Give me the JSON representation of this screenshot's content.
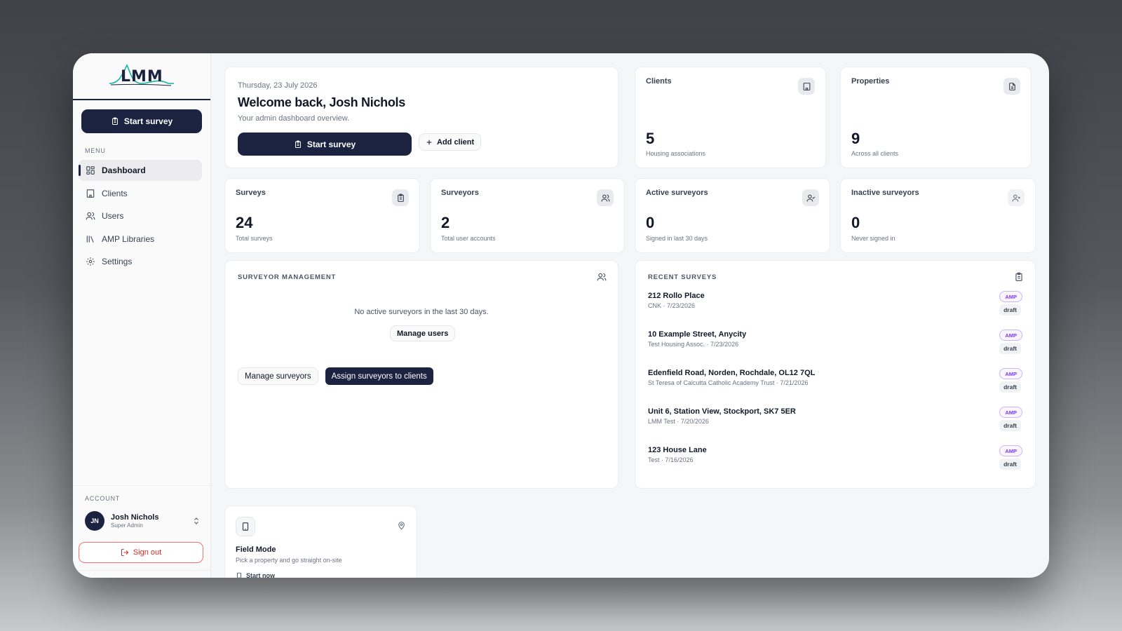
{
  "app": {
    "logo_text": "LMM"
  },
  "sidebar": {
    "start_survey_label": "Start survey",
    "menu_label": "MENU",
    "items": [
      {
        "label": "Dashboard",
        "icon": "grid-icon",
        "active": true
      },
      {
        "label": "Clients",
        "icon": "building-icon"
      },
      {
        "label": "Users",
        "icon": "users-icon"
      },
      {
        "label": "AMP Libraries",
        "icon": "library-icon"
      },
      {
        "label": "Settings",
        "icon": "gear-icon"
      }
    ],
    "account_label": "ACCOUNT",
    "account": {
      "initials": "JN",
      "name": "Josh Nichols",
      "role": "Super Admin"
    },
    "sign_out_label": "Sign out"
  },
  "welcome": {
    "date": "Thursday, 23 July 2026",
    "title": "Welcome back, Josh Nichols",
    "subtitle": "Your admin dashboard overview.",
    "start_survey_label": "Start survey",
    "add_client_label": "Add client"
  },
  "stats": {
    "clients": {
      "title": "Clients",
      "value": "5",
      "label": "Housing associations"
    },
    "properties": {
      "title": "Properties",
      "value": "9",
      "label": "Across all clients"
    },
    "surveys": {
      "title": "Surveys",
      "value": "24",
      "label": "Total surveys"
    },
    "surveyors": {
      "title": "Surveyors",
      "value": "2",
      "label": "Total user accounts"
    },
    "active": {
      "title": "Active surveyors",
      "value": "0",
      "label": "Signed in last 30 days"
    },
    "inactive": {
      "title": "Inactive surveyors",
      "value": "0",
      "label": "Never signed in"
    }
  },
  "management": {
    "title": "SURVEYOR MANAGEMENT",
    "empty_text": "No active surveyors in the last 30 days.",
    "manage_users_label": "Manage users",
    "manage_surveyors_label": "Manage surveyors",
    "assign_label": "Assign surveyors to clients"
  },
  "recent": {
    "title": "RECENT SURVEYS",
    "surveys": [
      {
        "name": "212 Rollo Place",
        "meta": "CNK · 7/23/2026",
        "type": "AMP",
        "status": "draft"
      },
      {
        "name": "10 Example Street, Anycity",
        "meta": "Test Housing Assoc. · 7/23/2026",
        "type": "AMP",
        "status": "draft"
      },
      {
        "name": "Edenfield Road, Norden, Rochdale, OL12 7QL",
        "meta": "St Teresa of Calcutta Catholic Academy Trust · 7/21/2026",
        "type": "AMP",
        "status": "draft"
      },
      {
        "name": "Unit 6, Station View, Stockport, SK7 5ER",
        "meta": "LMM Test · 7/20/2026",
        "type": "AMP",
        "status": "draft"
      },
      {
        "name": "123 House Lane",
        "meta": "Test · 7/16/2026",
        "type": "AMP",
        "status": "draft"
      }
    ]
  },
  "field_mode": {
    "title": "Field Mode",
    "description": "Pick a property and go straight on-site",
    "start_label": "Start now"
  },
  "colors": {
    "primary": "#1b2340",
    "danger": "#dc2626",
    "amp_badge": "#7c3aed"
  }
}
